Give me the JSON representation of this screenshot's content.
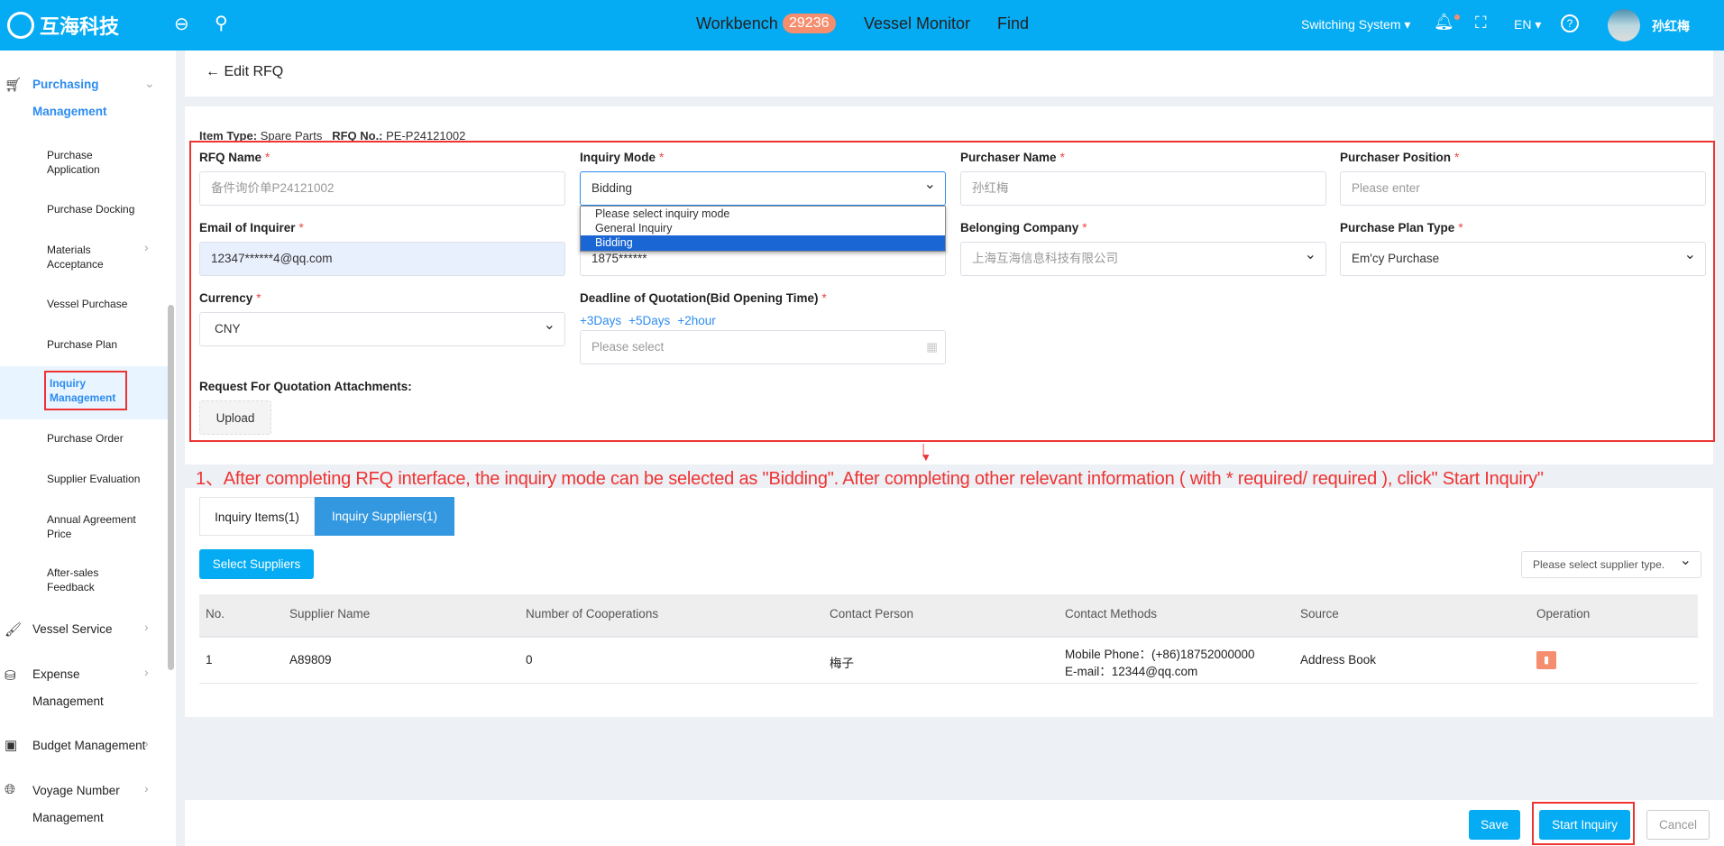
{
  "header": {
    "logo_text": "互海科技",
    "nav": [
      {
        "label": "Workbench",
        "badge": "29236"
      },
      {
        "label": "Vessel Monitor"
      },
      {
        "label": "Find"
      }
    ],
    "switch_system": "Switching System",
    "language": "EN",
    "user_name": "孙红梅",
    "color": "#05abf3"
  },
  "sidebar": {
    "group": {
      "label1": "Purchasing",
      "label2": "Management"
    },
    "items": [
      "Purchase Application",
      "Purchase Docking",
      "Materials Acceptance",
      "Vessel Purchase",
      "Purchase Plan",
      "Inquiry Management",
      "Purchase Order",
      "Supplier Evaluation",
      "Annual Agreement Price",
      "After-sales Feedback"
    ],
    "menus": [
      {
        "label": "Vessel Service"
      },
      {
        "label": "Expense",
        "label2": "Management"
      },
      {
        "label": "Budget Management"
      },
      {
        "label": "Voyage Number",
        "label2": "Management"
      }
    ]
  },
  "page": {
    "back_title": "Edit RFQ",
    "item_type_label": "Item Type:",
    "item_type": "Spare Parts",
    "rfq_no_label": "RFQ No.:",
    "rfq_no": "PE-P24121002"
  },
  "form": {
    "rfq_name": {
      "label": "RFQ Name",
      "value": "备件询价单P24121002"
    },
    "inquiry_mode": {
      "label": "Inquiry Mode",
      "value": "Bidding",
      "options": [
        "Please select inquiry mode",
        "General Inquiry",
        "Bidding"
      ]
    },
    "purchaser_name": {
      "label": "Purchaser Name",
      "value": "孙红梅"
    },
    "purchaser_position": {
      "label": "Purchaser Position",
      "placeholder": "Please enter"
    },
    "email": {
      "label": "Email of Inquirer",
      "value": "12347******4@qq.com"
    },
    "phone": {
      "value": "1875******"
    },
    "company": {
      "label": "Belonging Company",
      "value": "上海互海信息科技有限公司"
    },
    "plan_type": {
      "label": "Purchase Plan Type",
      "value": "Em'cy Purchase"
    },
    "currency": {
      "label": "Currency",
      "value": "CNY"
    },
    "deadline": {
      "label": "Deadline of Quotation(Bid Opening Time)",
      "quick": [
        "+3Days",
        "+5Days",
        "+2hour"
      ],
      "placeholder": "Please select"
    },
    "attachments": {
      "label": "Request For Quotation Attachments:",
      "upload": "Upload"
    },
    "required_mark": "*"
  },
  "annotation": "1、After completing RFQ interface, the inquiry mode can be selected as \"Bidding\". After completing other relevant information ( with * required/ required ), click\" Start Inquiry\"",
  "tabs": [
    "Inquiry Items(1)",
    "Inquiry Suppliers(1)"
  ],
  "suppliers": {
    "select_button": "Select Suppliers",
    "type_placeholder": "Please select supplier type.",
    "columns": [
      "No.",
      "Supplier Name",
      "Number of Cooperations",
      "Contact Person",
      "Contact Methods",
      "Source",
      "Operation"
    ],
    "rows": [
      {
        "no": "1",
        "name": "A89809",
        "cooperations": "0",
        "contact": "梅子",
        "mobile": "Mobile Phone：(+86)18752000000",
        "email": "E-mail：12344@qq.com",
        "source": "Address Book"
      }
    ]
  },
  "footer": {
    "save": "Save",
    "start": "Start Inquiry",
    "cancel": "Cancel"
  }
}
